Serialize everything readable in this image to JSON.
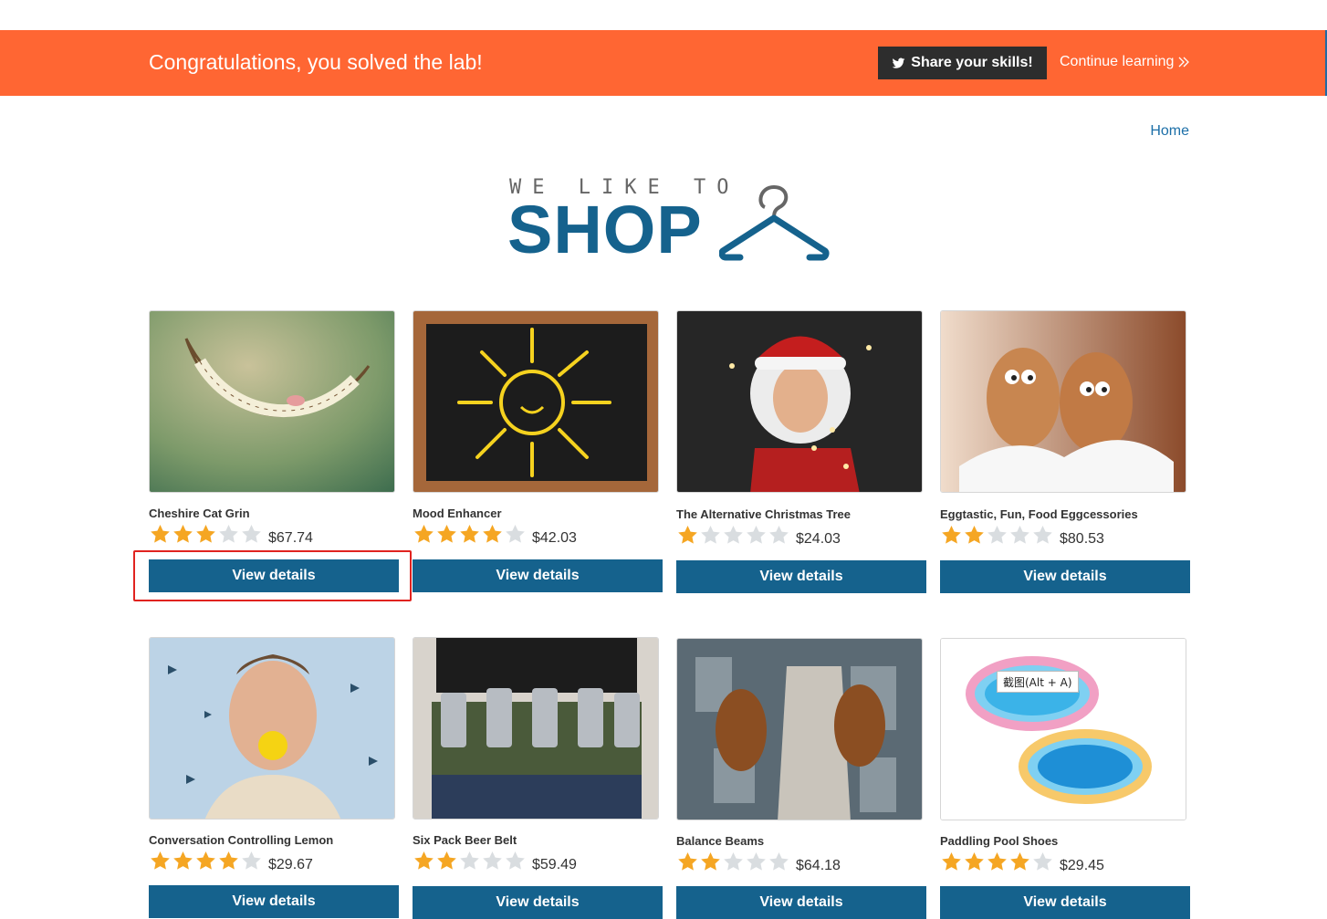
{
  "banner": {
    "title": "Congratulations, you solved the lab!",
    "share_label": "Share your skills!",
    "continue_label": "Continue learning",
    "background_color": "#ff6633"
  },
  "nav": {
    "home_label": "Home"
  },
  "logo": {
    "top_text": "WE LIKE TO",
    "main_text": "SHOP"
  },
  "products": [
    {
      "name": "Cheshire Cat Grin",
      "rating": 3,
      "price": "$67.74",
      "button": "View details",
      "image": "cheshire-grin"
    },
    {
      "name": "Mood Enhancer",
      "rating": 4,
      "price": "$42.03",
      "button": "View details",
      "image": "chalkboard-sun"
    },
    {
      "name": "The Alternative Christmas Tree",
      "rating": 1,
      "price": "$24.03",
      "button": "View details",
      "image": "santa-lights"
    },
    {
      "name": "Eggtastic, Fun, Food Eggcessories",
      "rating": 2,
      "price": "$80.53",
      "button": "View details",
      "image": "eggs-feathers"
    },
    {
      "name": "Conversation Controlling Lemon",
      "rating": 4,
      "price": "$29.67",
      "button": "View details",
      "image": "man-lemon"
    },
    {
      "name": "Six Pack Beer Belt",
      "rating": 2,
      "price": "$59.49",
      "button": "View details",
      "image": "beer-belt"
    },
    {
      "name": "Balance Beams",
      "rating": 2,
      "price": "$64.18",
      "button": "View details",
      "image": "city-beam"
    },
    {
      "name": "Paddling Pool Shoes",
      "rating": 4,
      "price": "$29.45",
      "button": "View details",
      "image": "paddling-pools"
    }
  ],
  "tooltip": {
    "text": "截图(Alt + A)"
  },
  "colors": {
    "accent": "#15628d",
    "star": "#f5a623",
    "star_empty": "#d9dde0",
    "highlight": "#e0231f"
  }
}
